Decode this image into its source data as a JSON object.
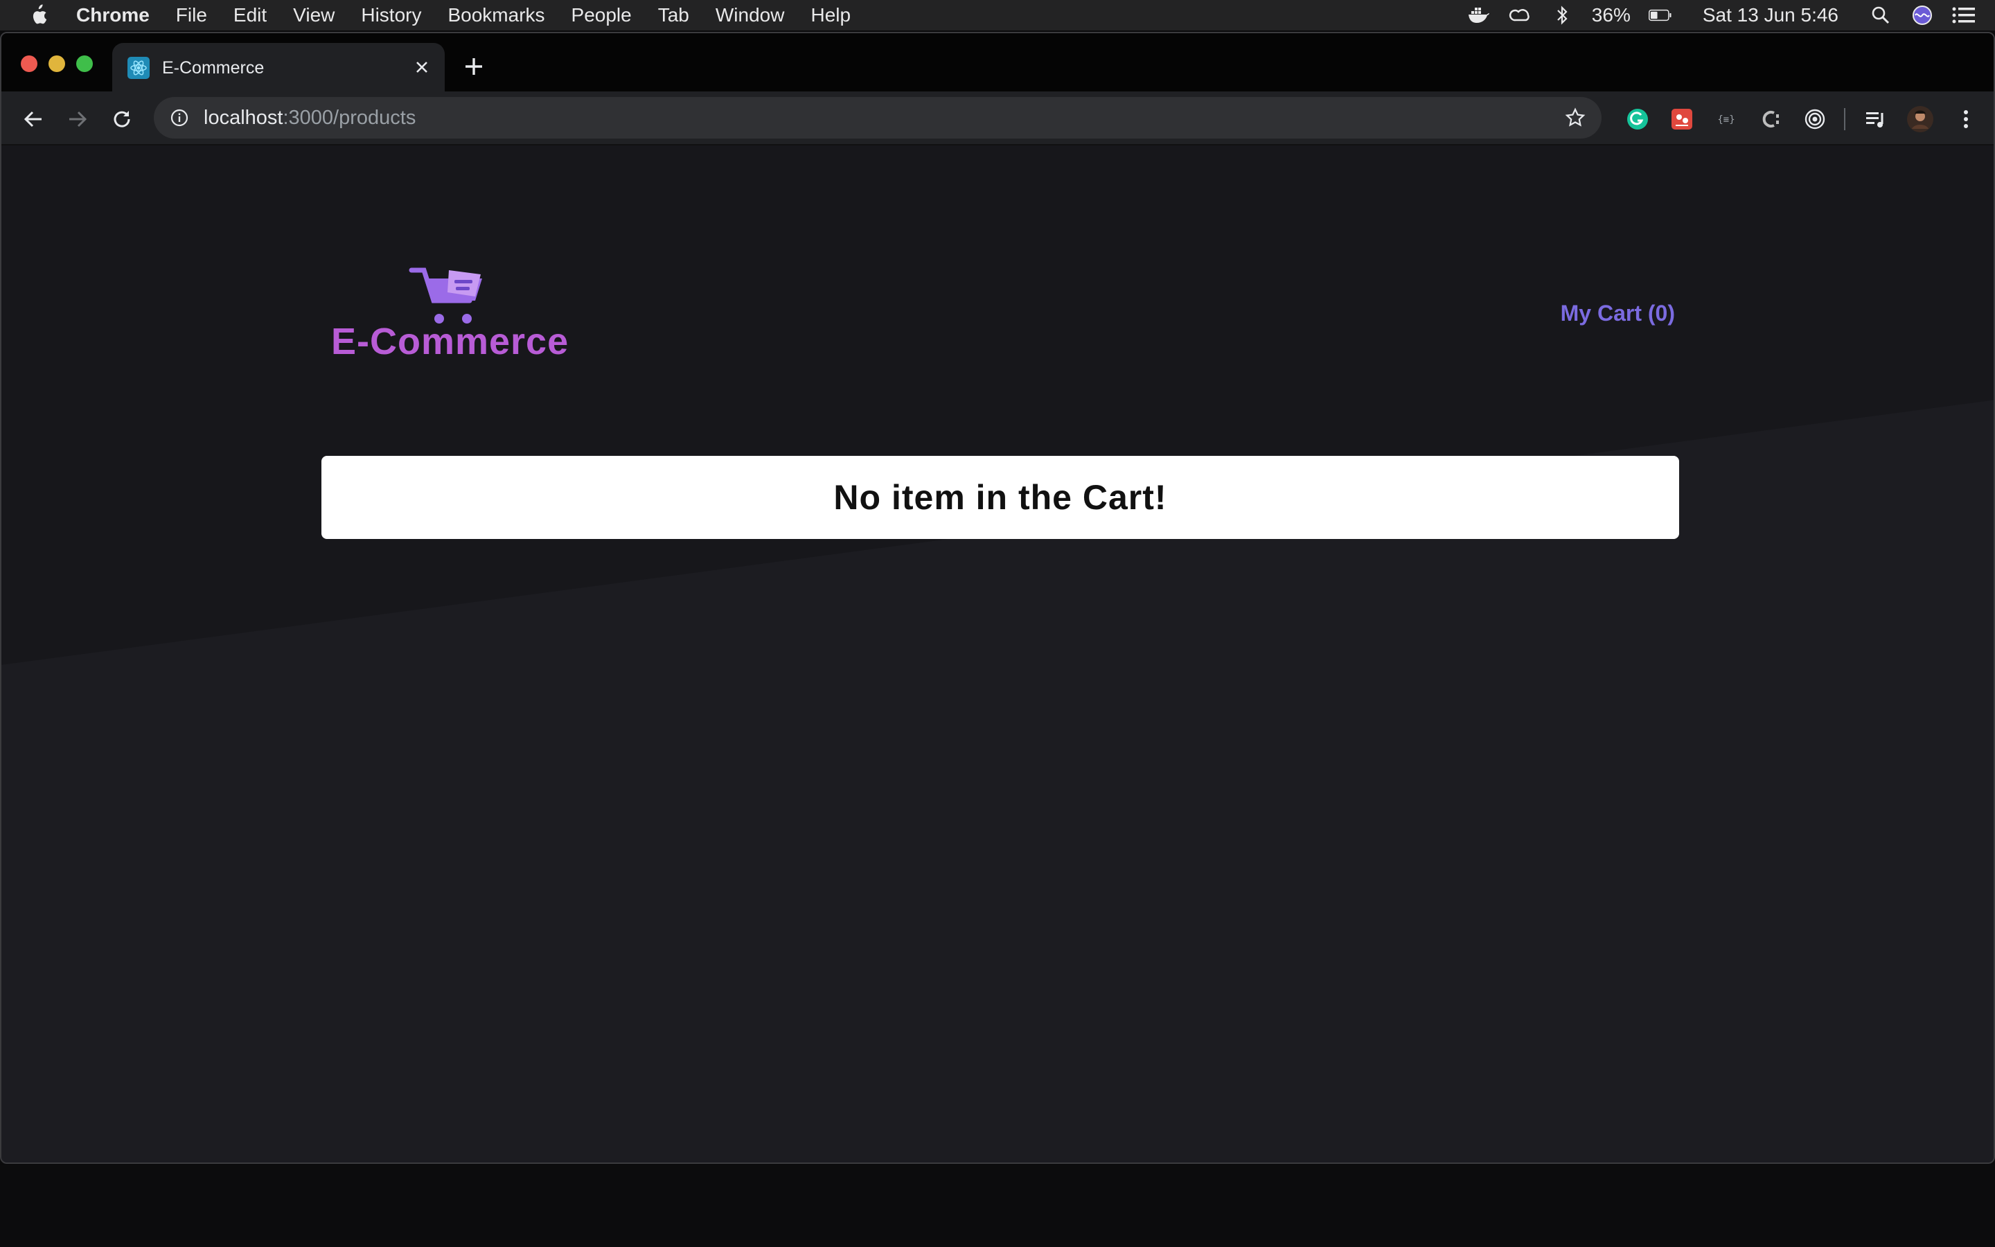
{
  "menubar": {
    "app": "Chrome",
    "items": [
      "File",
      "Edit",
      "View",
      "History",
      "Bookmarks",
      "People",
      "Tab",
      "Window",
      "Help"
    ],
    "battery": "36%",
    "clock": "Sat 13 Jun  5:46"
  },
  "browser": {
    "tab_title": "E-Commerce",
    "url_host": "localhost",
    "url_path": ":3000/products"
  },
  "page": {
    "logo_text": "E-Commerce",
    "cart_link": "My Cart (0)",
    "empty_message": "No item in the Cart!"
  },
  "colors": {
    "accent_purple": "#b85cd6",
    "cart_link": "#7b6be0",
    "page_bg": "#1c1c21"
  }
}
